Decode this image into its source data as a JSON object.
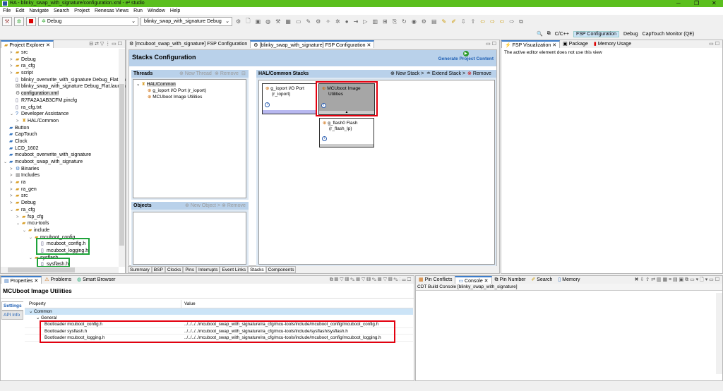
{
  "window": {
    "title": "RA - blinky_swap_with_signature/configuration.xml - e² studio",
    "min": "─",
    "max": "❐",
    "close": "✕"
  },
  "menu": [
    "File",
    "Edit",
    "Navigate",
    "Search",
    "Project",
    "Renesas Views",
    "Run",
    "Window",
    "Help"
  ],
  "toolbar": {
    "build_config": "Debug",
    "launch_config": "blinky_swap_with_signature Debug"
  },
  "perspectives": {
    "cpp": "C/C++",
    "fsp": "FSP Configuration",
    "debug": "Debug",
    "captouch": "CapTouch Monitor (QE)"
  },
  "project_explorer": {
    "tab": "Project Explorer",
    "items": [
      {
        "label": "src",
        "depth": 1,
        "tw": ">",
        "ic": "folder"
      },
      {
        "label": "Debug",
        "depth": 1,
        "tw": ">",
        "ic": "folder"
      },
      {
        "label": "ra_cfg",
        "depth": 1,
        "tw": ">",
        "ic": "folder"
      },
      {
        "label": "script",
        "depth": 1,
        "tw": ">",
        "ic": "folder"
      },
      {
        "label": "blinky_overwrite_with_signature Debug_Flat.jlink",
        "depth": 1,
        "tw": "",
        "ic": "file"
      },
      {
        "label": "blinky_swap_with_signature Debug_Flat.launch",
        "depth": 1,
        "tw": "",
        "ic": "launch"
      },
      {
        "label": "configuration.xml",
        "depth": 1,
        "tw": "",
        "ic": "gear",
        "sel": true
      },
      {
        "label": "R7FA2A1AB3CFM.pincfg",
        "depth": 1,
        "tw": "",
        "ic": "file"
      },
      {
        "label": "ra_cfg.txt",
        "depth": 1,
        "tw": "",
        "ic": "file"
      },
      {
        "label": "Developer Assistance",
        "depth": 1,
        "tw": "v",
        "ic": "help"
      },
      {
        "label": "HAL/Common",
        "depth": 2,
        "tw": ">",
        "ic": "hal"
      },
      {
        "label": "Button",
        "depth": 0,
        "tw": "",
        "ic": "project"
      },
      {
        "label": "CapTouch",
        "depth": 0,
        "tw": "",
        "ic": "project"
      },
      {
        "label": "Clock",
        "depth": 0,
        "tw": "",
        "ic": "project"
      },
      {
        "label": "LCD_1602",
        "depth": 0,
        "tw": "",
        "ic": "project"
      },
      {
        "label": "mcuboot_overwrite_with_signature",
        "depth": 0,
        "tw": "",
        "ic": "project"
      },
      {
        "label": "mcuboot_swap_with_signature",
        "depth": 0,
        "tw": "v",
        "ic": "project"
      },
      {
        "label": "Binaries",
        "depth": 1,
        "tw": ">",
        "ic": "bin"
      },
      {
        "label": "Includes",
        "depth": 1,
        "tw": ">",
        "ic": "inc"
      },
      {
        "label": "ra",
        "depth": 1,
        "tw": ">",
        "ic": "folder"
      },
      {
        "label": "ra_gen",
        "depth": 1,
        "tw": ">",
        "ic": "folder"
      },
      {
        "label": "src",
        "depth": 1,
        "tw": ">",
        "ic": "folder"
      },
      {
        "label": "Debug",
        "depth": 1,
        "tw": ">",
        "ic": "folder"
      },
      {
        "label": "ra_cfg",
        "depth": 1,
        "tw": "v",
        "ic": "folder"
      },
      {
        "label": "fsp_cfg",
        "depth": 2,
        "tw": ">",
        "ic": "folder"
      },
      {
        "label": "mcu-tools",
        "depth": 2,
        "tw": "v",
        "ic": "folder"
      },
      {
        "label": "include",
        "depth": 3,
        "tw": "v",
        "ic": "folder"
      },
      {
        "label": "mcuboot_config",
        "depth": 4,
        "tw": "v",
        "ic": "folder"
      },
      {
        "label": "mcuboot_config.h",
        "depth": 5,
        "tw": "",
        "ic": "h"
      },
      {
        "label": "mcuboot_logging.h",
        "depth": 5,
        "tw": "",
        "ic": "h"
      },
      {
        "label": "sysflash",
        "depth": 4,
        "tw": "v",
        "ic": "folder"
      },
      {
        "label": "sysflash.h",
        "depth": 5,
        "tw": "",
        "ic": "h"
      }
    ]
  },
  "editor": {
    "tabs": [
      "[mcuboot_swap_with_signature] FSP Configuration",
      "[blinky_swap_with_signature] FSP Configuration"
    ],
    "title": "Stacks Configuration",
    "generate": "Generate Project Content",
    "threads": {
      "title": "Threads",
      "new": "New Thread",
      "remove": "Remove",
      "root": "HAL/Common",
      "items": [
        "g_ioport I/O Port (r_ioport)",
        "MCUboot Image Utilities"
      ]
    },
    "objects": {
      "title": "Objects",
      "new": "New Object >",
      "remove": "Remove"
    },
    "stacks": {
      "title": "HAL/Common Stacks",
      "new": "New Stack >",
      "extend": "Extend Stack >",
      "remove": "Remove",
      "cards": [
        {
          "line1": "g_ioport I/O Port",
          "line2": "(r_ioport)"
        },
        {
          "line1": "MCUboot Image",
          "line2": "Utilities"
        },
        {
          "line1": "g_flash0 Flash",
          "line2": "(r_flash_lp)"
        }
      ]
    },
    "bottom_tabs": [
      "Summary",
      "BSP",
      "Clocks",
      "Pins",
      "Interrupts",
      "Event Links",
      "Stacks",
      "Components"
    ]
  },
  "right_panel": {
    "tabs": [
      "FSP Visualization",
      "Package",
      "Memory Usage"
    ],
    "message": "The active editor element does not use this view"
  },
  "properties": {
    "tabs": [
      "Properties",
      "Problems",
      "Smart Browser"
    ],
    "title": "MCUboot Image Utilities",
    "side_tabs": [
      "Settings",
      "API Info"
    ],
    "columns": [
      "Property",
      "Value"
    ],
    "group": "Common",
    "subgroup": "General",
    "rows": [
      {
        "name": "Bootloader mcuboot_config.h",
        "value": "../../../../mcuboot_swap_with_signature/ra_cfg/mcu-tools/include/mcuboot_config/mcuboot_config.h"
      },
      {
        "name": "Bootloader sysflash.h",
        "value": "../../../../mcuboot_swap_with_signature/ra_cfg/mcu-tools/include/sysflash/sysflash.h"
      },
      {
        "name": "Bootloader mcuboot_logging.h",
        "value": "../../../../mcuboot_swap_with_signature/ra_cfg/mcu-tools/include/mcuboot_config/mcuboot_logging.h"
      }
    ]
  },
  "console": {
    "tabs": [
      "Pin Conflicts",
      "Console",
      "Pin Number",
      "Search",
      "Memory"
    ],
    "header": "CDT Build Console [blinky_swap_with_signature]"
  }
}
